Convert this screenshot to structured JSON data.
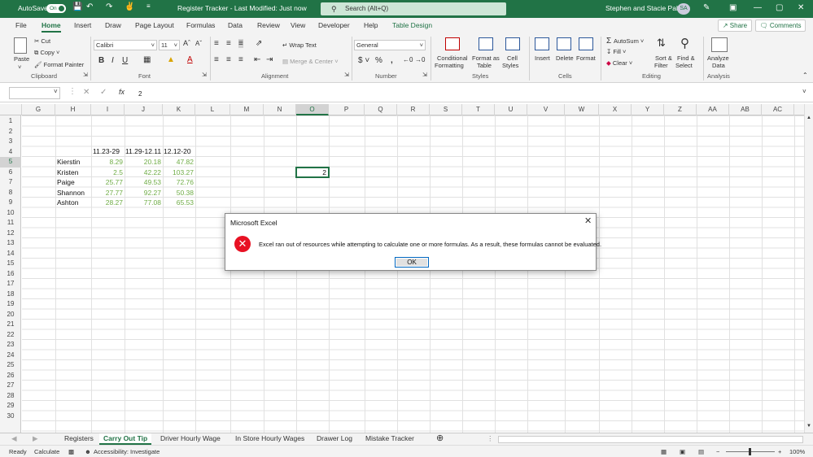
{
  "titlebar": {
    "autosave_label": "AutoSave",
    "autosave_state": "On",
    "doc_title": "Register Tracker  -  Last Modified: Just now",
    "search_placeholder": "Search (Alt+Q)",
    "user_name": "Stephen and Stacie Pales",
    "user_initials": "SA",
    "accent": "#217346"
  },
  "tabs": [
    "File",
    "Home",
    "Insert",
    "Draw",
    "Page Layout",
    "Formulas",
    "Data",
    "Review",
    "View",
    "Developer",
    "Help",
    "Table Design"
  ],
  "share_label": "Share",
  "comments_label": "Comments",
  "ribbon": {
    "clipboard": {
      "paste": "Paste",
      "cut": "Cut",
      "copy": "Copy",
      "format_painter": "Format Painter",
      "label": "Clipboard"
    },
    "font": {
      "name": "Calibri",
      "size": "11",
      "label": "Font"
    },
    "alignment": {
      "wrap": "Wrap Text",
      "merge": "Merge & Center",
      "label": "Alignment"
    },
    "number": {
      "format": "General",
      "label": "Number"
    },
    "styles": {
      "conditional": "Conditional",
      "conditional2": "Formatting",
      "format_table": "Format as",
      "format_table2": "Table",
      "cell_styles": "Cell",
      "cell_styles2": "Styles",
      "label": "Styles"
    },
    "cells": {
      "insert": "Insert",
      "delete": "Delete",
      "format": "Format",
      "label": "Cells"
    },
    "editing": {
      "autosum": "AutoSum",
      "fill": "Fill",
      "clear": "Clear",
      "sort": "Sort &",
      "sort2": "Filter",
      "find": "Find &",
      "find2": "Select",
      "label": "Editing"
    },
    "analysis": {
      "analyze": "Analyze",
      "analyze2": "Data",
      "label": "Analysis"
    }
  },
  "formulabar": {
    "namebox": "",
    "fx": "fx",
    "value": "2"
  },
  "columns": [
    "G",
    "H",
    "I",
    "J",
    "K",
    "L",
    "M",
    "N",
    "O",
    "P",
    "Q",
    "R",
    "S",
    "T",
    "U",
    "V",
    "W",
    "X",
    "Y",
    "Z",
    "AA",
    "AB",
    "AC"
  ],
  "selected_column": "O",
  "rows": [
    1,
    2,
    3,
    4,
    5,
    6,
    7,
    8,
    9,
    10,
    11,
    12,
    13,
    14,
    15,
    16,
    17,
    18,
    19,
    20,
    21,
    22,
    23,
    24,
    25,
    26,
    27,
    28,
    29,
    30
  ],
  "selected_row": 5,
  "table": {
    "headers": [
      "11.23-29",
      "11.29-12.11",
      "12.12-20"
    ],
    "rows": [
      {
        "name": "Kierstin",
        "values": [
          "8.29",
          "20.18",
          "47.82"
        ]
      },
      {
        "name": "Kristen",
        "values": [
          "2.5",
          "42.22",
          "103.27"
        ]
      },
      {
        "name": "Paige",
        "values": [
          "25.77",
          "49.53",
          "72.76"
        ]
      },
      {
        "name": "Shannon",
        "values": [
          "27.77",
          "92.27",
          "50.38"
        ]
      },
      {
        "name": "Ashton",
        "values": [
          "28.27",
          "77.08",
          "65.53"
        ]
      }
    ]
  },
  "active_cell_value": "2",
  "sheets": [
    "Registers",
    "Carry Out Tip",
    "Driver Hourly Wage",
    "In Store Hourly Wages",
    "Drawer Log",
    "Mistake Tracker"
  ],
  "active_sheet": "Carry Out Tip",
  "status": {
    "ready": "Ready",
    "calculate": "Calculate",
    "accessibility": "Accessibility: Investigate",
    "zoom": "100%"
  },
  "dialog": {
    "title": "Microsoft Excel",
    "message": "Excel ran out of resources while attempting to calculate one or more formulas. As a result, these formulas cannot be evaluated.",
    "ok": "OK"
  }
}
